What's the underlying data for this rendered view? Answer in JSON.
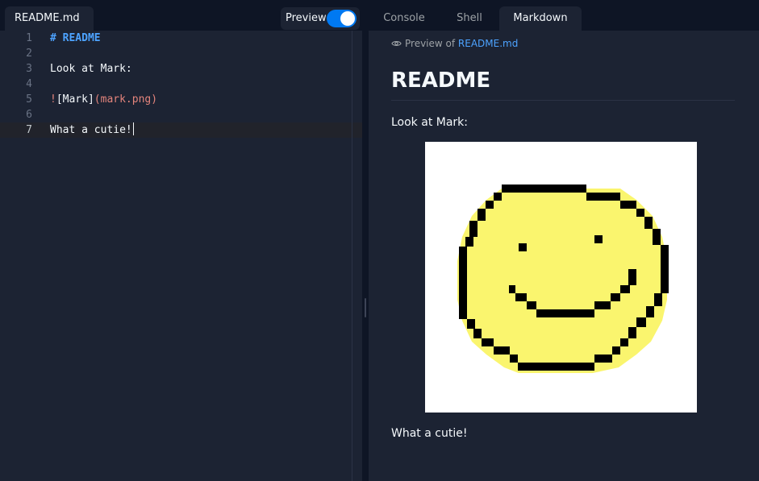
{
  "editor": {
    "file_tab": "README.md",
    "preview_label": "Preview",
    "preview_enabled": true,
    "lines": [
      {
        "num": "1",
        "text": "# README"
      },
      {
        "num": "2",
        "text": ""
      },
      {
        "num": "3",
        "text": "Look at Mark:"
      },
      {
        "num": "4",
        "text": ""
      },
      {
        "num": "5",
        "text_bang": "!",
        "text_alt": "[Mark]",
        "text_url": "(mark.png)"
      },
      {
        "num": "6",
        "text": ""
      },
      {
        "num": "7",
        "text": "What a cutie!"
      }
    ]
  },
  "right_panel": {
    "tabs": [
      "Console",
      "Shell",
      "Markdown"
    ],
    "active_tab": "Markdown",
    "preview_of_label": "Preview of",
    "preview_file": "README.md",
    "markdown": {
      "heading": "README",
      "paragraph_1": "Look at Mark:",
      "image_alt": "Mark",
      "paragraph_2": "What a cutie!"
    }
  },
  "colors": {
    "accent": "#0079f2",
    "link": "#4da3ff",
    "smiley_fill": "#faf56e"
  },
  "icons": [
    "eye-icon",
    "smiley-image"
  ]
}
